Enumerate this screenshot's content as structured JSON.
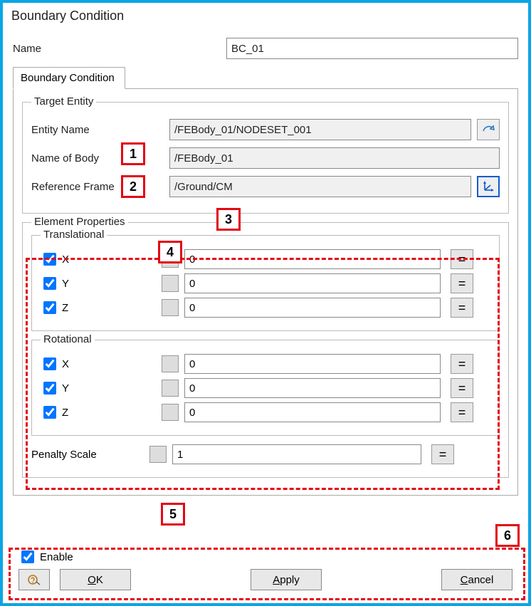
{
  "title": "Boundary Condition",
  "nameLabel": "Name",
  "nameValue": "BC_01",
  "tab": "Boundary Condition",
  "targetEntity": {
    "groupTitle": "Target Entity",
    "entityNameLabel": "Entity Name",
    "entityNameValue": "/FEBody_01/NODESET_001",
    "bodyLabel": "Name of Body",
    "bodyValue": "/FEBody_01",
    "refFrameLabel": "Reference Frame",
    "refFrameValue": "/Ground/CM"
  },
  "elementProps": {
    "groupTitle": "Element Properties",
    "translational": {
      "title": "Translational",
      "x": {
        "label": "X",
        "checked": true,
        "value": "0"
      },
      "y": {
        "label": "Y",
        "checked": true,
        "value": "0"
      },
      "z": {
        "label": "Z",
        "checked": true,
        "value": "0"
      }
    },
    "rotational": {
      "title": "Rotational",
      "x": {
        "label": "X",
        "checked": true,
        "value": "0"
      },
      "y": {
        "label": "Y",
        "checked": true,
        "value": "0"
      },
      "z": {
        "label": "Z",
        "checked": true,
        "value": "0"
      }
    },
    "penaltyLabel": "Penalty Scale",
    "penaltyValue": "1"
  },
  "enableLabel": "Enable",
  "enableChecked": true,
  "buttons": {
    "ok": "OK",
    "apply": "Apply",
    "cancel": "Cancel"
  },
  "eq": "=",
  "callouts": {
    "c1": "1",
    "c2": "2",
    "c3": "3",
    "c4": "4",
    "c5": "5",
    "c6": "6"
  }
}
